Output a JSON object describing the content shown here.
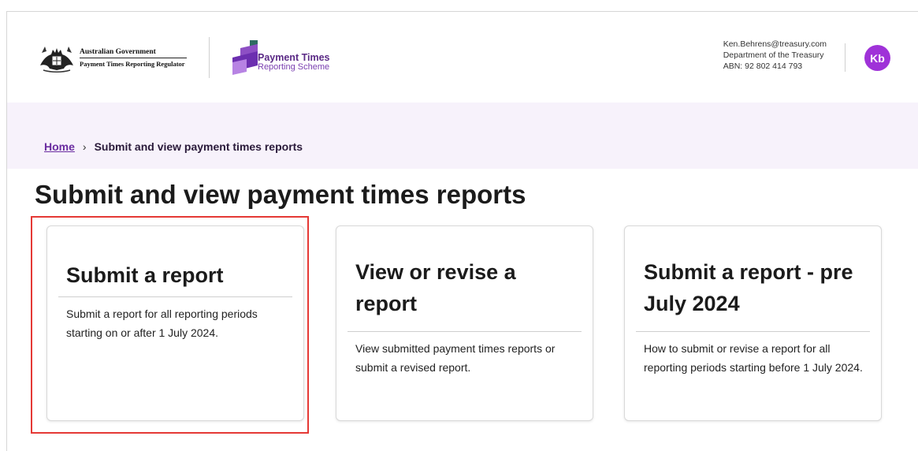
{
  "header": {
    "gov_line1": "Australian Government",
    "gov_line2": "Payment Times Reporting Regulator",
    "scheme_title": "Payment Times",
    "scheme_sub": "Reporting Scheme"
  },
  "user": {
    "email": "Ken.Behrens@treasury.com",
    "department": "Department of the Treasury",
    "abn": "ABN: 92 802 414 793",
    "initials": "Kb",
    "avatar_color": "#9f32d8"
  },
  "breadcrumb": {
    "home": "Home",
    "separator": "›",
    "current": "Submit and view payment times reports"
  },
  "page": {
    "title": "Submit and view payment times reports"
  },
  "cards": [
    {
      "title": "Submit a report",
      "description": "Submit a report for all reporting periods starting on or after 1 July 2024."
    },
    {
      "title": "View or revise a report",
      "description": "View submitted payment times reports or submit a revised report."
    },
    {
      "title": "Submit a report - pre July 2024",
      "description": "How to submit or revise a report for all reporting periods starting before 1 July 2024."
    }
  ],
  "colors": {
    "accent": "#6a2ca0",
    "breadcrumb_bg": "#f7f2fb",
    "highlight": "#e53935"
  }
}
